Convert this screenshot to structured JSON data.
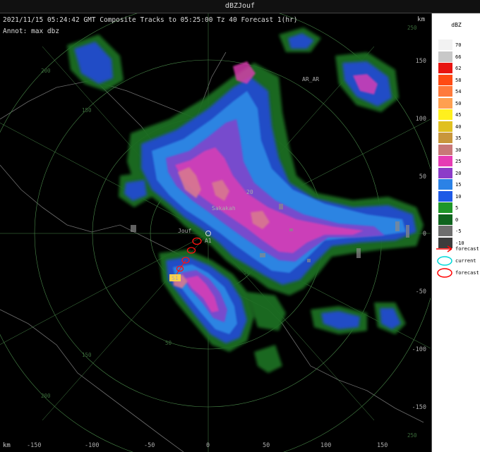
{
  "window": {
    "title": "dBZJouf"
  },
  "header": {
    "line": "2021/11/15 05:24:42 GMT Composite Tracks to 05:25:00 Tz 40 Forecast 1(hr)",
    "annot": "Annot: max dbz"
  },
  "axes": {
    "unit": "km",
    "x_ticks": [
      "-150",
      "-100",
      "-50",
      "0",
      "50",
      "100",
      "150"
    ],
    "y_ticks": [
      "150",
      "100",
      "50",
      "0",
      "-50",
      "-100",
      "-150"
    ],
    "corner_label": "250"
  },
  "range_rings": [
    "50",
    "100",
    "150",
    "200"
  ],
  "places": [
    {
      "name": "Jouf"
    },
    {
      "name": "AR_AR"
    },
    {
      "name": "Sakakah"
    }
  ],
  "storm_labels": [
    "A1",
    "20",
    "S1"
  ],
  "legend": {
    "title": "dBZ",
    "scale": [
      {
        "value": "70",
        "color": "#f2f2f2"
      },
      {
        "value": "66",
        "color": "#c8c8c8"
      },
      {
        "value": "62",
        "color": "#e81410"
      },
      {
        "value": "58",
        "color": "#ff4b14"
      },
      {
        "value": "54",
        "color": "#ff7a3c"
      },
      {
        "value": "50",
        "color": "#ffa050"
      },
      {
        "value": "45",
        "color": "#fff01e"
      },
      {
        "value": "40",
        "color": "#e0c020"
      },
      {
        "value": "35",
        "color": "#c8963c"
      },
      {
        "value": "30",
        "color": "#c87878"
      },
      {
        "value": "25",
        "color": "#e63cb4"
      },
      {
        "value": "20",
        "color": "#8c3cc8"
      },
      {
        "value": "15",
        "color": "#2b82e6"
      },
      {
        "value": "10",
        "color": "#1e5ae6"
      },
      {
        "value": "5",
        "color": "#1e9628"
      },
      {
        "value": "0",
        "color": "#0f641e"
      },
      {
        "value": "-5",
        "color": "#6e6e6e"
      },
      {
        "value": "-10",
        "color": "#3c3c3c"
      }
    ],
    "tracks": [
      {
        "label": "forecast",
        "symbol": "red-arrow",
        "color": "#ff0000"
      },
      {
        "label": "current",
        "symbol": "cyan-ellipse",
        "color": "#00e0e0"
      },
      {
        "label": "forecast",
        "symbol": "red-ellipse",
        "color": "#ff0000"
      }
    ]
  }
}
